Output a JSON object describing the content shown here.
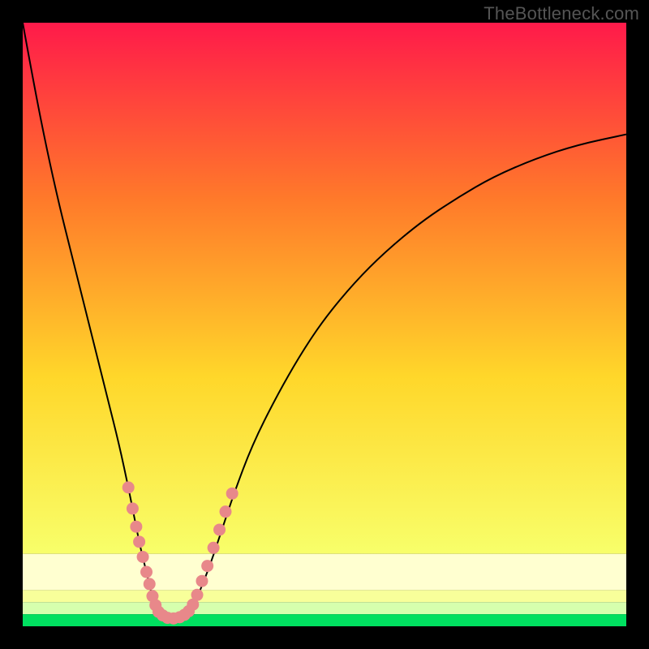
{
  "watermark": "TheBottleneck.com",
  "colors": {
    "frame": "#000000",
    "gradient_top": "#ff1a4a",
    "gradient_mid_upper": "#ff7a2a",
    "gradient_mid": "#ffd72a",
    "gradient_lower": "#f8ff6a",
    "gradient_pale": "#ffffd0",
    "gradient_bottom": "#00e060",
    "curve": "#000000",
    "markers": "#e8888a"
  },
  "chart_data": {
    "type": "line",
    "title": "",
    "xlabel": "",
    "ylabel": "",
    "xlim": [
      0,
      100
    ],
    "ylim": [
      0,
      100
    ],
    "grid": false,
    "legend": false,
    "series": [
      {
        "name": "left-branch",
        "x": [
          0,
          2,
          4,
          6,
          8,
          10,
          12,
          14,
          16,
          17.5,
          18.5,
          19.5,
          20.5,
          21.2,
          21.8,
          22.2
        ],
        "values": [
          100,
          89,
          79,
          70,
          62,
          54,
          46,
          38,
          30,
          23,
          18,
          13,
          9,
          6,
          3.5,
          2.2
        ]
      },
      {
        "name": "valley-floor",
        "x": [
          22.2,
          23.0,
          24.0,
          25.0,
          26.0,
          27.0,
          27.8
        ],
        "values": [
          2.2,
          1.7,
          1.4,
          1.3,
          1.4,
          1.7,
          2.2
        ]
      },
      {
        "name": "right-branch",
        "x": [
          27.8,
          29,
          31,
          33,
          35,
          38,
          42,
          46,
          50,
          55,
          60,
          66,
          72,
          78,
          85,
          92,
          100
        ],
        "values": [
          2.2,
          5,
          10,
          16,
          22,
          30,
          38,
          45,
          51,
          57,
          62,
          67,
          71,
          74.5,
          77.5,
          79.8,
          81.5
        ]
      }
    ],
    "markers": {
      "name": "highlighted-points",
      "points": [
        {
          "x": 17.5,
          "y": 23
        },
        {
          "x": 18.2,
          "y": 19.5
        },
        {
          "x": 18.8,
          "y": 16.5
        },
        {
          "x": 19.3,
          "y": 14
        },
        {
          "x": 19.9,
          "y": 11.5
        },
        {
          "x": 20.5,
          "y": 9
        },
        {
          "x": 21.0,
          "y": 7
        },
        {
          "x": 21.5,
          "y": 5
        },
        {
          "x": 22.0,
          "y": 3.5
        },
        {
          "x": 22.5,
          "y": 2.4
        },
        {
          "x": 23.2,
          "y": 1.8
        },
        {
          "x": 24.0,
          "y": 1.4
        },
        {
          "x": 25.0,
          "y": 1.3
        },
        {
          "x": 26.0,
          "y": 1.5
        },
        {
          "x": 26.8,
          "y": 1.9
        },
        {
          "x": 27.5,
          "y": 2.5
        },
        {
          "x": 28.2,
          "y": 3.6
        },
        {
          "x": 28.9,
          "y": 5.2
        },
        {
          "x": 29.7,
          "y": 7.5
        },
        {
          "x": 30.6,
          "y": 10
        },
        {
          "x": 31.6,
          "y": 13
        },
        {
          "x": 32.6,
          "y": 16
        },
        {
          "x": 33.6,
          "y": 19
        },
        {
          "x": 34.7,
          "y": 22
        }
      ]
    },
    "gradient_bands": [
      {
        "y_from": 100,
        "y_to": 12,
        "type": "smooth",
        "colors": [
          "#ff1a4a",
          "#ff7a2a",
          "#ffd72a",
          "#f8ff6a"
        ]
      },
      {
        "y_from": 12,
        "y_to": 6,
        "type": "solid",
        "color": "#ffffd0"
      },
      {
        "y_from": 6,
        "y_to": 4,
        "type": "solid",
        "color": "#f8ff9a"
      },
      {
        "y_from": 4,
        "y_to": 2,
        "type": "solid",
        "color": "#d6ffae"
      },
      {
        "y_from": 2,
        "y_to": 0,
        "type": "solid",
        "color": "#00e060"
      }
    ]
  }
}
